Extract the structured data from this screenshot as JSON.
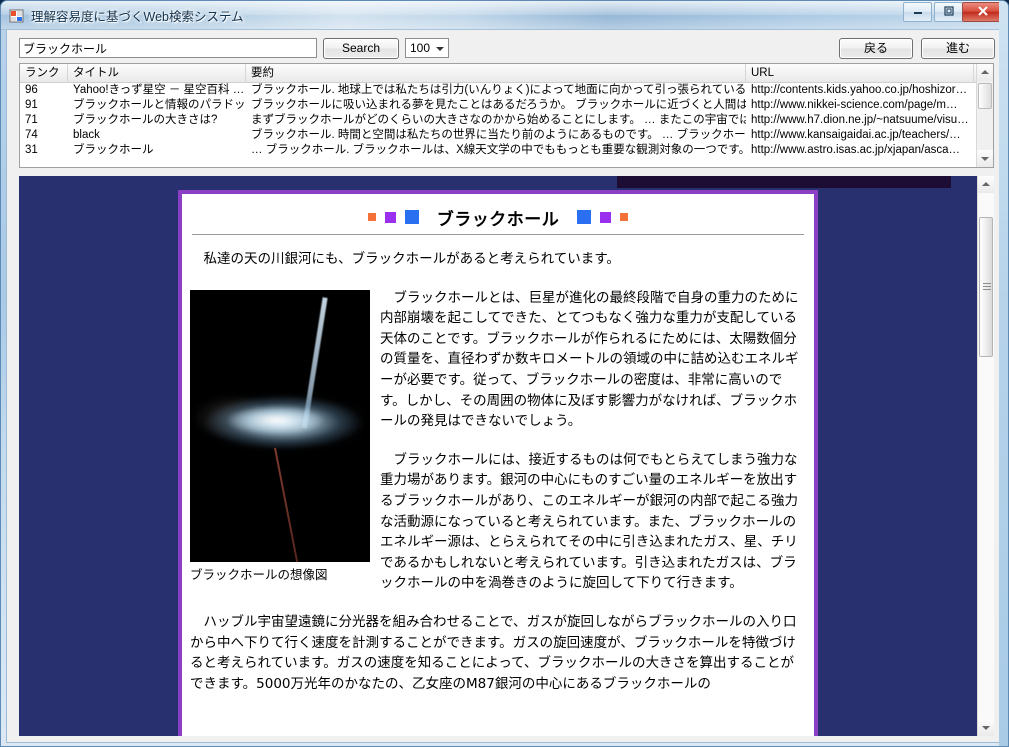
{
  "window": {
    "title": "理解容易度に基づくWeb検索システム",
    "icon": "app-window-icon",
    "minimize_glyph": "—",
    "maximize_glyph": "❐",
    "close_glyph": "✕"
  },
  "toolbar": {
    "query_value": "ブラックホール",
    "query_placeholder": "",
    "search_label": "Search",
    "count_value": "100",
    "back_label": "戻る",
    "forward_label": "進む"
  },
  "grid": {
    "columns": [
      "ランク",
      "タイトル",
      "要約",
      "URL"
    ],
    "rows": [
      {
        "rank": "96",
        "title": "Yahoo!きっず星空 － 星空百科 …",
        "summary": "ブラックホール. 地球上では私たちは引力(いんりょく)によって地面に向かって引っ張られている。 … これをブ…",
        "url": "http://contents.kids.yahoo.co.jp/hoshizor…"
      },
      {
        "rank": "91",
        "title": "ブラックホールと情報のパラドックス…",
        "summary": "ブラックホールに吸い込まれる夢を見たことはあるだろうか。 ブラックホールに近づくと人間は紙のように薄くな…",
        "url": "http://www.nikkei-science.com/page/m…"
      },
      {
        "rank": "71",
        "title": "ブラックホールの大きさは?",
        "summary": "まずブラックホールがどのくらいの大きさなのかから始めることにします。 … またこの宇宙ではふつうの星やブラッ…",
        "url": "http://www.h7.dion.ne.jp/~natsuume/visu…"
      },
      {
        "rank": "74",
        "title": "black",
        "summary": "ブラックホール. 時間と空間は私たちの世界に当たり前のようにあるものです。 … ブラックホールは、見たこと…",
        "url": "http://www.kansaigaidai.ac.jp/teachers/…"
      },
      {
        "rank": "31",
        "title": "ブラックホール",
        "summary": "… ブラックホール. ブラックホールは、X線天文学の中でももっとも重要な観測対象の一つです。この章では…",
        "url": "http://www.astro.isas.ac.jp/xjapan/asca…"
      }
    ]
  },
  "document": {
    "heading": "ブラックホール",
    "decorations_left": [
      {
        "name": "deco-square-orange-small",
        "color": "#f4713a",
        "size": "small"
      },
      {
        "name": "deco-square-purple-medium",
        "color": "#9b2ff0",
        "size": "medium"
      },
      {
        "name": "deco-square-blue-large",
        "color": "#2a6ff0",
        "size": "large"
      }
    ],
    "decorations_right": [
      {
        "name": "deco-square-blue-large",
        "color": "#2a6ff0",
        "size": "large"
      },
      {
        "name": "deco-square-purple-medium",
        "color": "#9b2ff0",
        "size": "medium"
      },
      {
        "name": "deco-square-orange-small",
        "color": "#f4713a",
        "size": "small"
      }
    ],
    "figure_caption": "ブラックホールの想像図",
    "figure_alt": "black-hole-accretion-disk-image",
    "paragraphs": [
      "私達の天の川銀河にも、ブラックホールがあると考えられています。",
      "ブラックホールとは、巨星が進化の最終段階で自身の重力のために内部崩壊を起こしてできた、とてつもなく強力な重力が支配している天体のことです。ブラックホールが作られるにためには、太陽数個分の質量を、直径わずか数キロメートルの領域の中に詰め込むエネルギーが必要です。従って、ブラックホールの密度は、非常に高いのです。しかし、その周囲の物体に及ぼす影響力がなければ、ブラックホールの発見はできないでしょう。",
      "ブラックホールには、接近するものは何でもとらえてしまう強力な重力場があります。銀河の中心にものすごい量のエネルギーを放出するブラックホールがあり、このエネルギーが銀河の内部で起こる強力な活動源になっていると考えられています。また、ブラックホールのエネルギー源は、とらえられてその中に引き込まれたガス、星、チリであるかもしれないと考えられています。引き込まれたガスは、ブラックホールの中を渦巻きのように旋回して下りて行きます。",
      "ハッブル宇宙望遠鏡に分光器を組み合わせることで、ガスが旋回しながらブラックホールの入り口から中へ下りて行く速度を計測することができます。ガスの旋回速度が、ブラックホールを特徴づけると考えられています。ガスの速度を知ることによって、ブラックホールの大きさを算出することができます。5000万光年のかなたの、乙女座のM87銀河の中心にあるブラックホールの"
    ]
  },
  "colors": {
    "viewer_background": "#28306f",
    "viewer_band": "#1d0d35",
    "document_border": "#8b3fc4",
    "accent_orange": "#f4713a",
    "accent_purple": "#9b2ff0",
    "accent_blue": "#2a6ff0"
  },
  "scrollbars": {
    "up_arrow": "▲",
    "down_arrow": "▼"
  }
}
